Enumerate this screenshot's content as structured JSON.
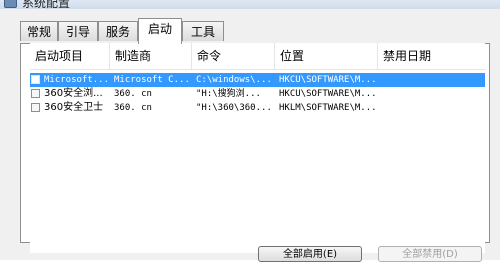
{
  "window": {
    "title": "系统配置"
  },
  "tabs": [
    {
      "label": "常规"
    },
    {
      "label": "引导"
    },
    {
      "label": "服务"
    },
    {
      "label": "启动"
    },
    {
      "label": "工具"
    }
  ],
  "active_tab": "启动",
  "table": {
    "columns": [
      "启动项目",
      "制造商",
      "命令",
      "位置",
      "禁用日期"
    ],
    "rows": [
      {
        "item": "Microsoft...",
        "maker": "Microsoft C...",
        "command": "C:\\windows\\...",
        "location": "HKCU\\SOFTWARE\\M...",
        "date": "",
        "checked": false,
        "selected": true
      },
      {
        "item": "360安全浏...",
        "maker": "360. cn",
        "command": "\"H:\\搜狗浏...",
        "location": "HKCU\\SOFTWARE\\M...",
        "date": "",
        "checked": false,
        "selected": false
      },
      {
        "item": "360安全卫士",
        "maker": "360. cn",
        "command": "\"H:\\360\\360...",
        "location": "HKLM\\SOFTWARE\\M...",
        "date": "",
        "checked": false,
        "selected": false
      }
    ]
  },
  "buttons": {
    "enable_all": "全部启用(E)",
    "disable_all": "全部禁用(D)"
  },
  "colors": {
    "selection": "#3399ff",
    "tab_border": "#8e8f8f",
    "window_bg": "#f0f0f0"
  }
}
